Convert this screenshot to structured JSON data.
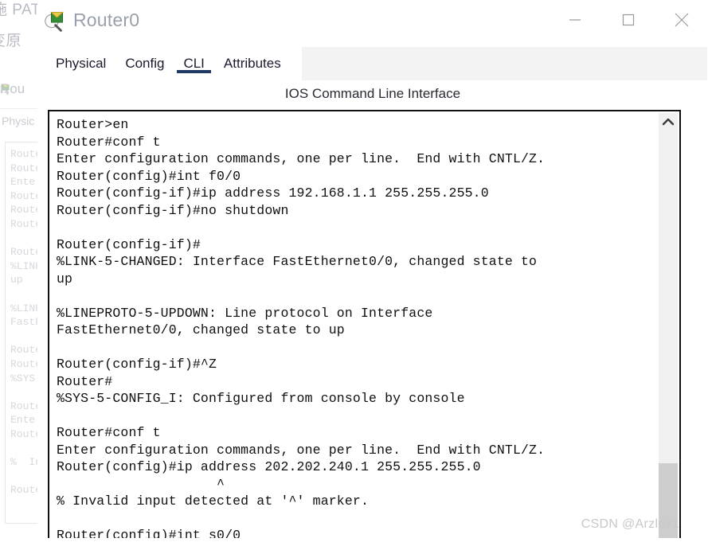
{
  "background_window": {
    "cjk_fragment_top": "施 PAT",
    "cjk_fragment_second": "变原",
    "title": "Rou",
    "tab_label": "Physic",
    "terminal_fragment": "Route\nRoute\nEnte\nRoute\nRoute\nRoute\n\nRoute\n%LINK\nup\n\n%LINE\nFastE\n\nRoute\nRoute\n%SYS-\n\nRoute\nEnte\nRoute\n\n%  In\n\nRoute"
  },
  "window": {
    "title": "Router0",
    "icon": "packet-tracer-router-icon",
    "controls": {
      "minimize": "minimize-icon",
      "maximize": "maximize-icon",
      "close": "close-icon"
    }
  },
  "tabs": [
    {
      "label": "Physical",
      "active": false
    },
    {
      "label": "Config",
      "active": false
    },
    {
      "label": "CLI",
      "active": true
    },
    {
      "label": "Attributes",
      "active": false
    }
  ],
  "cli": {
    "header": "IOS Command Line Interface",
    "terminal_text": "Router>en\nRouter#conf t\nEnter configuration commands, one per line.  End with CNTL/Z.\nRouter(config)#int f0/0\nRouter(config-if)#ip address 192.168.1.1 255.255.255.0\nRouter(config-if)#no shutdown\n\nRouter(config-if)#\n%LINK-5-CHANGED: Interface FastEthernet0/0, changed state to\nup\n\n%LINEPROTO-5-UPDOWN: Line protocol on Interface\nFastEthernet0/0, changed state to up\n\nRouter(config-if)#^Z\nRouter#\n%SYS-5-CONFIG_I: Configured from console by console\n\nRouter#conf t\nEnter configuration commands, one per line.  End with CNTL/Z.\nRouter(config)#ip address 202.202.240.1 255.255.255.0\n                    ^\n% Invalid input detected at '^' marker.\n\nRouter(config)#int s0/0"
  },
  "scrollbar": {
    "up_arrow": "chevron-up-icon"
  },
  "watermark": "CSDN @Arzlov1",
  "colors": {
    "accent": "#1f3864",
    "terminal_text": "#101010",
    "title_text": "#9aa0ab",
    "tabstrip_bg": "#f3f3f3",
    "scrollbar_track": "#f0f0f0",
    "scrollbar_thumb": "#cdcdcd"
  }
}
